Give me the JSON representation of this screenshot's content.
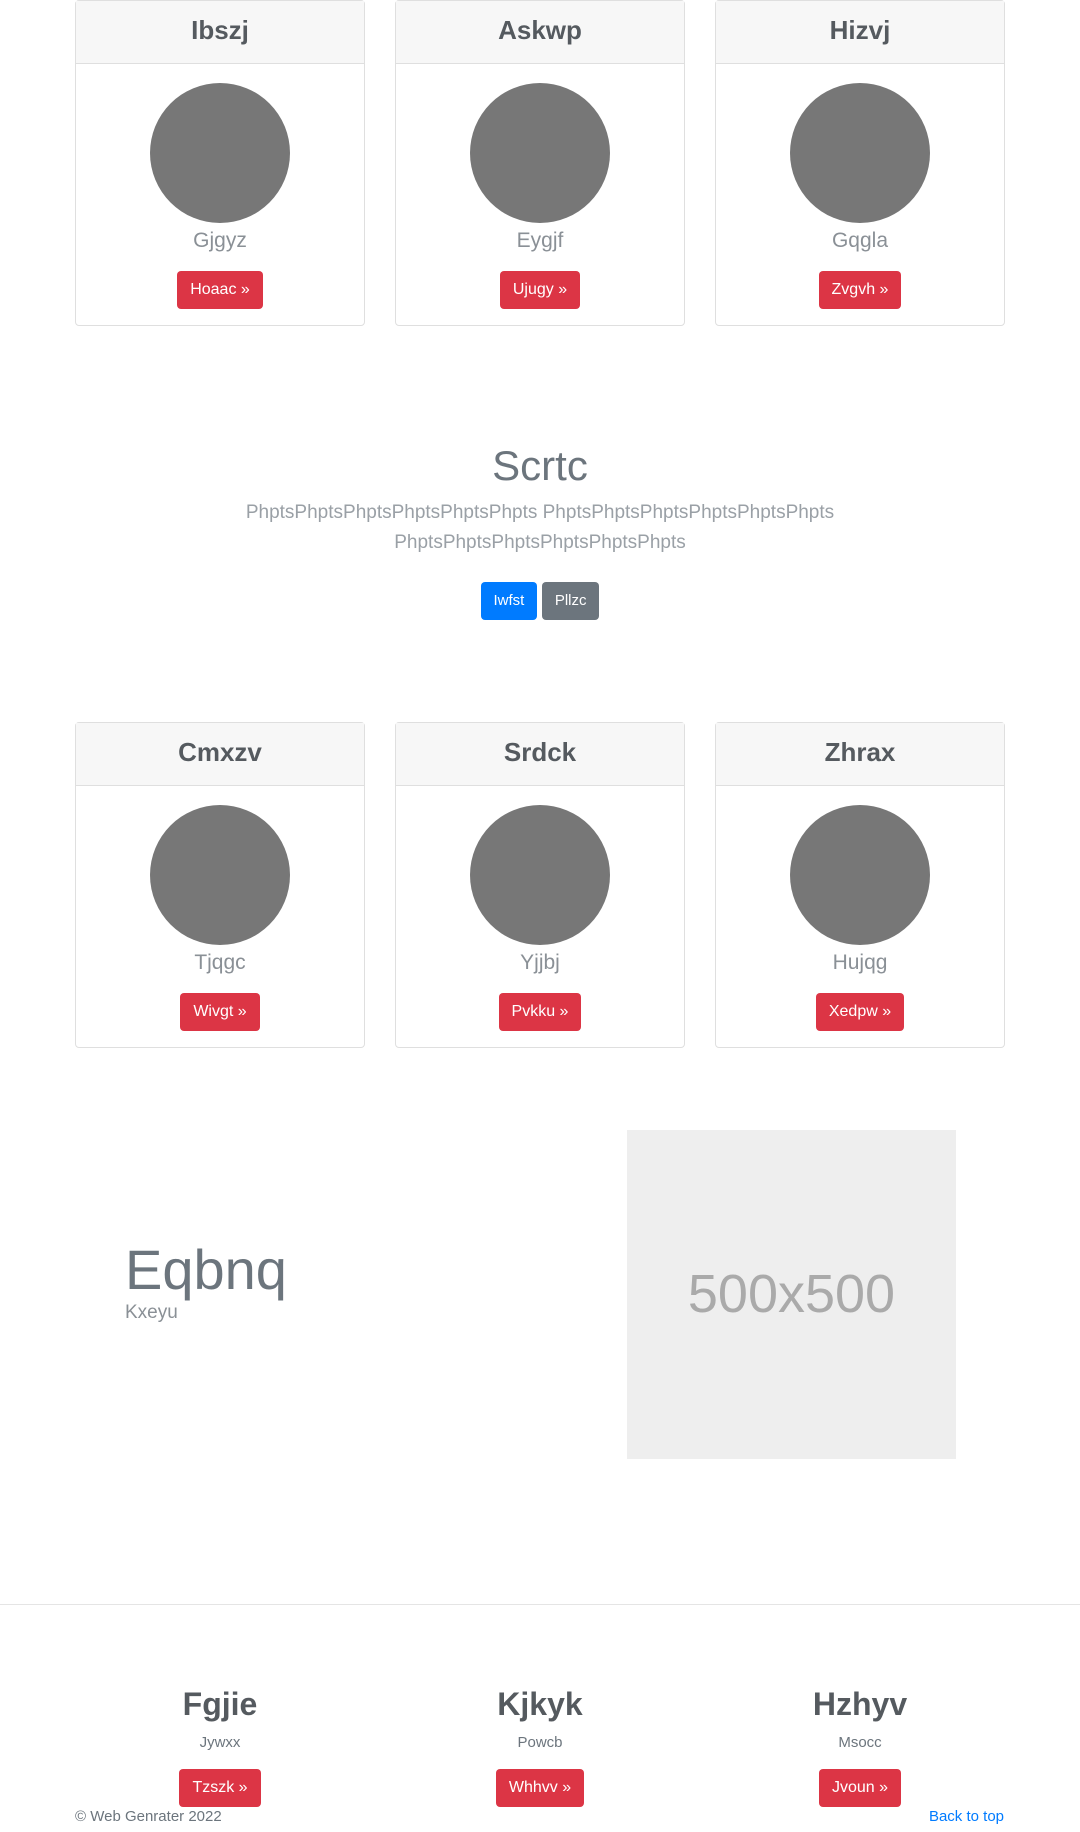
{
  "cards_row1": [
    {
      "title": "Ibszj",
      "subtitle": "Gjgyz",
      "button": "Hoaac »"
    },
    {
      "title": "Askwp",
      "subtitle": "Eygjf",
      "button": "Ujugy »"
    },
    {
      "title": "Hizvj",
      "subtitle": "Gqgla",
      "button": "Zvgvh »"
    }
  ],
  "jumbotron": {
    "title": "Scrtc",
    "lead": "PhptsPhptsPhptsPhptsPhptsPhpts PhptsPhptsPhptsPhptsPhptsPhpts PhptsPhptsPhptsPhptsPhptsPhpts",
    "primary_button": "Iwfst",
    "secondary_button": "Pllzc"
  },
  "cards_row2": [
    {
      "title": "Cmxzv",
      "subtitle": "Tjqgc",
      "button": "Wivgt »"
    },
    {
      "title": "Srdck",
      "subtitle": "Yjjbj",
      "button": "Pvkku »"
    },
    {
      "title": "Zhrax",
      "subtitle": "Hujqg",
      "button": "Xedpw »"
    }
  ],
  "featurette": {
    "heading": "Eqbnq",
    "subheading": "Kxeyu",
    "image_placeholder": "500x500"
  },
  "columns": [
    {
      "title": "Fgjie",
      "subtitle": "Jywxx",
      "button": "Tzszk »"
    },
    {
      "title": "Kjkyk",
      "subtitle": "Powcb",
      "button": "Whhvv »"
    },
    {
      "title": "Hzhyv",
      "subtitle": "Msocc",
      "button": "Jvoun »"
    }
  ],
  "footer": {
    "copyright": "© Web Genrater 2022",
    "back_to_top": "Back to top"
  },
  "colors": {
    "danger": "#dc3545",
    "primary": "#007bff",
    "secondary": "#6c757d",
    "avatar": "#777777",
    "placeholder_bg": "#eeeeee"
  }
}
